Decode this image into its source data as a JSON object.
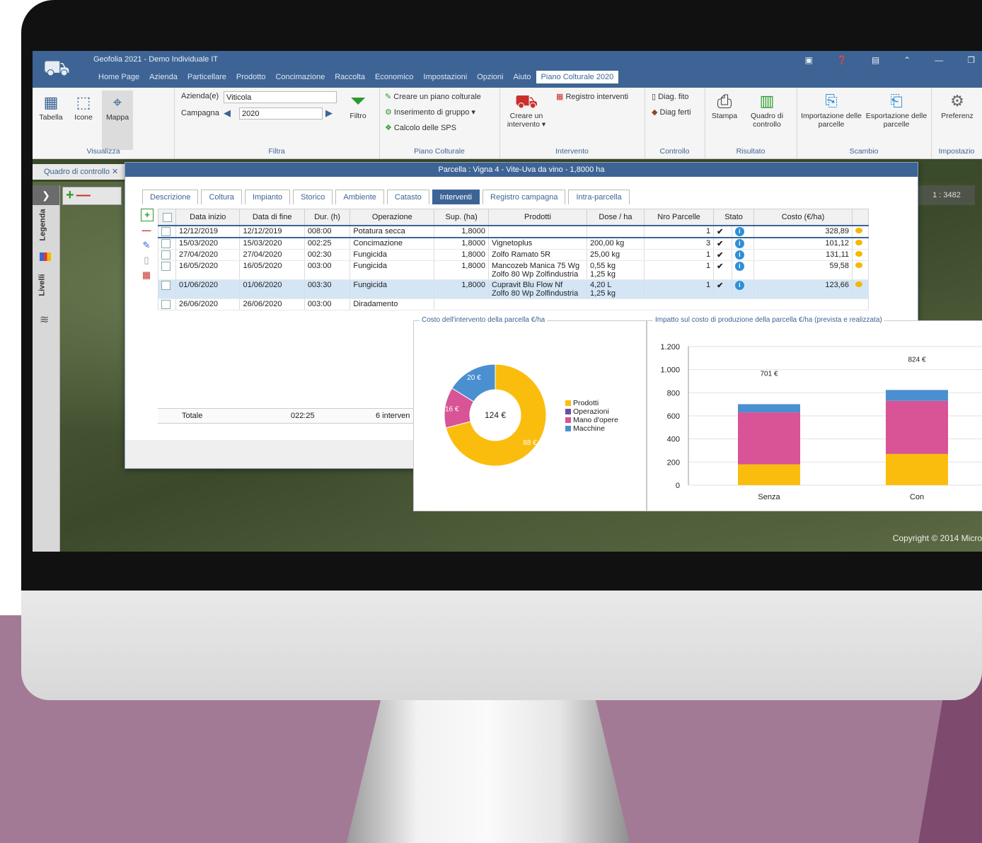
{
  "window": {
    "title": "Geofolia 2021 - Demo Individuale IT",
    "menu": [
      "Home Page",
      "Azienda",
      "Particellare",
      "Prodotto",
      "Concimazione",
      "Raccolta",
      "Economico",
      "Impostazioni",
      "Opzioni",
      "Aiuto",
      "Piano Colturale 2020"
    ],
    "active_menu": "Piano Colturale 2020"
  },
  "ribbon": {
    "visualizza": {
      "tabella": "Tabella",
      "icone": "Icone",
      "mappa": "Mappa",
      "label": "Visualizza"
    },
    "filtra": {
      "azienda_label": "Azienda(e)",
      "azienda_value": "Viticola",
      "campagna_label": "Campagna",
      "campagna_value": "2020",
      "filtro": "Filtro",
      "label": "Filtra"
    },
    "piano": {
      "creare": "Creare un piano colturale",
      "inserimento": "Inserimento di gruppo",
      "calcolo": "Calcolo delle SPS",
      "label": "Piano Colturale"
    },
    "intervento": {
      "creare": "Creare un intervento",
      "registro": "Registro interventi",
      "label": "Intervento"
    },
    "controllo": {
      "fito": "Diag. fito",
      "ferti": "Diag ferti",
      "label": "Controllo"
    },
    "risultato": {
      "stampa": "Stampa",
      "quadro": "Quadro di controllo",
      "label": "Risultato"
    },
    "scambio": {
      "importazione": "Importazione delle parcelle",
      "esportazione": "Esportazione delle parcelle",
      "label": "Scambio"
    },
    "impostazioni": {
      "preferenze": "Preferenz",
      "label": "Impostazio"
    }
  },
  "doc_tab": "Quadro di controllo",
  "sidebar": {
    "legenda": "Legenda",
    "livelli": "Livelli"
  },
  "map": {
    "scale": "1 : 3482",
    "copyright": "Copyright © 2014 Micro"
  },
  "dialog": {
    "title": "Parcella : Vigna 4 - Vite-Uva da vino - 1,8000 ha",
    "tabs": [
      "Descrizione",
      "Coltura",
      "Impianto",
      "Storico",
      "Ambiente",
      "Catasto",
      "Interventi",
      "Registro campagna",
      "Intra-parcella"
    ],
    "active_tab": "Interventi",
    "columns": [
      "Data inizio",
      "Data di fine",
      "Dur. (h)",
      "Operazione",
      "Sup. (ha)",
      "Prodotti",
      "Dose / ha",
      "Nro Parcelle",
      "Stato",
      "Costo (€/ha)"
    ],
    "rows": [
      {
        "inizio": "12/12/2019",
        "fine": "12/12/2019",
        "dur": "008:00",
        "op": "Potatura secca",
        "sup": "1,8000",
        "prodotti": [
          "",
          ""
        ],
        "dose": [
          "",
          ""
        ],
        "nro": "1",
        "costo": "328,89"
      },
      {
        "inizio": "15/03/2020",
        "fine": "15/03/2020",
        "dur": "002:25",
        "op": "Concimazione",
        "sup": "1,8000",
        "prodotti": [
          "Vignetoplus",
          ""
        ],
        "dose": [
          "200,00 kg",
          ""
        ],
        "nro": "3",
        "costo": "101,12"
      },
      {
        "inizio": "27/04/2020",
        "fine": "27/04/2020",
        "dur": "002:30",
        "op": "Fungicida",
        "sup": "1,8000",
        "prodotti": [
          "Zolfo Ramato 5R",
          ""
        ],
        "dose": [
          "25,00 kg",
          ""
        ],
        "nro": "1",
        "costo": "131,11"
      },
      {
        "inizio": "16/05/2020",
        "fine": "16/05/2020",
        "dur": "003:00",
        "op": "Fungicida",
        "sup": "1,8000",
        "prodotti": [
          "Mancozeb Manica 75 Wg",
          "Zolfo 80 Wp Zolfindustria"
        ],
        "dose": [
          "0,55 kg",
          "1,25 kg"
        ],
        "nro": "1",
        "costo": "59,58"
      },
      {
        "inizio": "01/06/2020",
        "fine": "01/06/2020",
        "dur": "003:30",
        "op": "Fungicida",
        "sup": "1,8000",
        "prodotti": [
          "Cupravit Blu Flow Nf",
          "Zolfo 80 Wp Zolfindustria"
        ],
        "dose": [
          "4,20 L",
          "1,25 kg"
        ],
        "nro": "1",
        "costo": "123,66"
      },
      {
        "inizio": "26/06/2020",
        "fine": "26/06/2020",
        "dur": "003:00",
        "op": "Diradamento",
        "sup": "",
        "prodotti": [
          "",
          ""
        ],
        "dose": [
          "",
          ""
        ],
        "nro": "",
        "costo": ""
      }
    ],
    "totale_label": "Totale",
    "totale_dur": "022:25",
    "totale_count": "6 interven"
  },
  "chart_data": [
    {
      "type": "pie",
      "title": "Costo dell'intervento della parcella €/ha",
      "center_label": "124 €",
      "categories": [
        "Prodotti",
        "Operazioni",
        "Mano d'opere",
        "Macchine"
      ],
      "values": [
        88,
        0,
        16,
        20
      ],
      "value_labels": [
        "88 €",
        "",
        "16 €",
        "20 €"
      ],
      "colors": [
        "#fbbd0d",
        "#6a4fa0",
        "#d85496",
        "#4a90d0"
      ]
    },
    {
      "type": "bar",
      "title": "Impatto sul costo di produzione della parcella €/ha (prevista e realizzata)",
      "categories": [
        "Senza",
        "Con"
      ],
      "series": [
        {
          "name": "Prodotti",
          "values": [
            180,
            270
          ]
        },
        {
          "name": "Mano d'opere",
          "values": [
            450,
            460
          ]
        },
        {
          "name": "Macchine",
          "values": [
            71,
            94
          ]
        }
      ],
      "totals": [
        "701 €",
        "824 €"
      ],
      "ylim": [
        0,
        1200
      ],
      "yticks": [
        "0",
        "200",
        "400",
        "600",
        "800",
        "1.000",
        "1.200"
      ],
      "colors": [
        "#fbbd0d",
        "#d85496",
        "#4a90d0"
      ]
    }
  ]
}
